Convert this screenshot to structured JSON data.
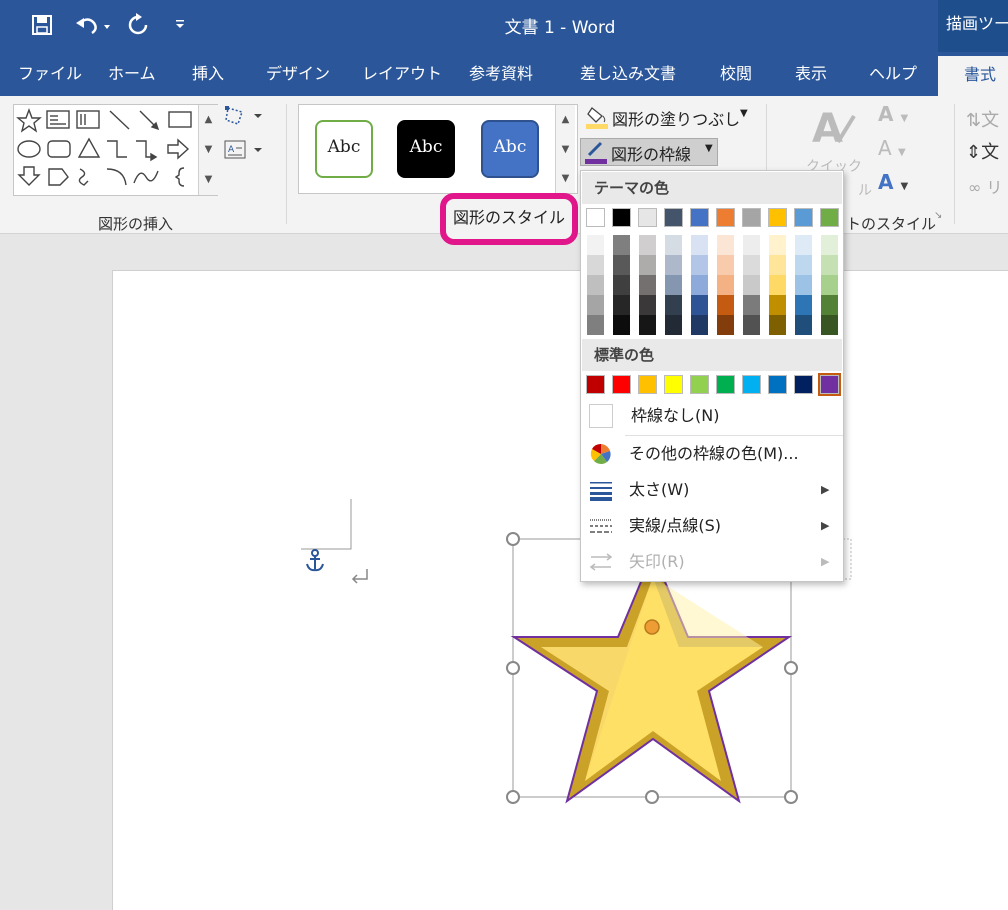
{
  "window": {
    "doc_title": "文書 1  -  Word",
    "context_tab_title": "描画ツール"
  },
  "qat": {
    "save_icon": "save-icon",
    "undo_icon": "undo-icon",
    "redo_icon": "redo-icon",
    "customize_icon": "customize-qat-icon"
  },
  "tabs": [
    {
      "label": "ファイル"
    },
    {
      "label": "ホーム"
    },
    {
      "label": "挿入"
    },
    {
      "label": "デザイン"
    },
    {
      "label": "レイアウト"
    },
    {
      "label": "参考資料"
    },
    {
      "label": "差し込み文書"
    },
    {
      "label": "校閲"
    },
    {
      "label": "表示"
    },
    {
      "label": "ヘルプ"
    },
    {
      "label": "書式"
    }
  ],
  "ribbon": {
    "insert_shapes_label": "図形の挿入",
    "shape_styles_label": "図形のスタイル",
    "style_thumbs": [
      {
        "label": "Abc",
        "fill": "#ffffff",
        "border": "#70ad47",
        "text": "#222222"
      },
      {
        "label": "Abc",
        "fill": "#000000",
        "border": "#000000",
        "text": "#ffffff"
      },
      {
        "label": "Abc",
        "fill": "#4472c4",
        "border": "#2f528f",
        "text": "#ffffff"
      }
    ],
    "fill_label": "図形の塗りつぶし",
    "outline_label": "図形の枠線",
    "wordart_label_partial": "トのスタイル",
    "quick_label_partial_1": "クイック",
    "quick_label_partial_2": "ル",
    "right_partial_1": "文",
    "right_partial_2": "文",
    "right_partial_3": "リ"
  },
  "outline_menu": {
    "theme_colors_header": "テーマの色",
    "standard_colors_header": "標準の色",
    "theme_colors_top": [
      "#ffffff",
      "#000000",
      "#e7e6e6",
      "#44546a",
      "#4472c4",
      "#ed7d31",
      "#a5a5a5",
      "#ffc000",
      "#5b9bd5",
      "#70ad47"
    ],
    "theme_colors_shades": [
      [
        "#f2f2f2",
        "#7f7f7f",
        "#d0cece",
        "#d6dce4",
        "#d9e2f3",
        "#fbe5d5",
        "#ededed",
        "#fff2cc",
        "#deeaf6",
        "#e2efd9"
      ],
      [
        "#d8d8d8",
        "#595959",
        "#aeabab",
        "#adb9ca",
        "#b4c6e7",
        "#f7cbac",
        "#dbdbdb",
        "#fee599",
        "#bdd7ee",
        "#c5e0b3"
      ],
      [
        "#bfbfbf",
        "#3f3f3f",
        "#757070",
        "#8496b0",
        "#8eaadb",
        "#f4b183",
        "#c9c9c9",
        "#ffd965",
        "#9cc3e5",
        "#a8d08d"
      ],
      [
        "#a5a5a5",
        "#262626",
        "#3a3838",
        "#323f4f",
        "#2f5496",
        "#c55a11",
        "#7b7b7b",
        "#bf8f00",
        "#2e75b5",
        "#538135"
      ],
      [
        "#7f7f7f",
        "#0c0c0c",
        "#171616",
        "#222a35",
        "#1f3864",
        "#833c0b",
        "#525252",
        "#7f6000",
        "#1e4e79",
        "#375623"
      ]
    ],
    "standard_colors": [
      "#c00000",
      "#ff0000",
      "#ffc000",
      "#ffff00",
      "#92d050",
      "#00b050",
      "#00b0f0",
      "#0070c0",
      "#002060",
      "#7030a0"
    ],
    "selected_standard_index": 9,
    "no_outline_label": "枠線なし(N)",
    "more_colors_label": "その他の枠線の色(M)...",
    "weight_label": "太さ(W)",
    "dashes_label": "実線/点線(S)",
    "arrows_label": "矢印(R)"
  },
  "document": {
    "shape": "star",
    "shape_fill": "#ffe066",
    "shape_outline": "#7030a0"
  }
}
